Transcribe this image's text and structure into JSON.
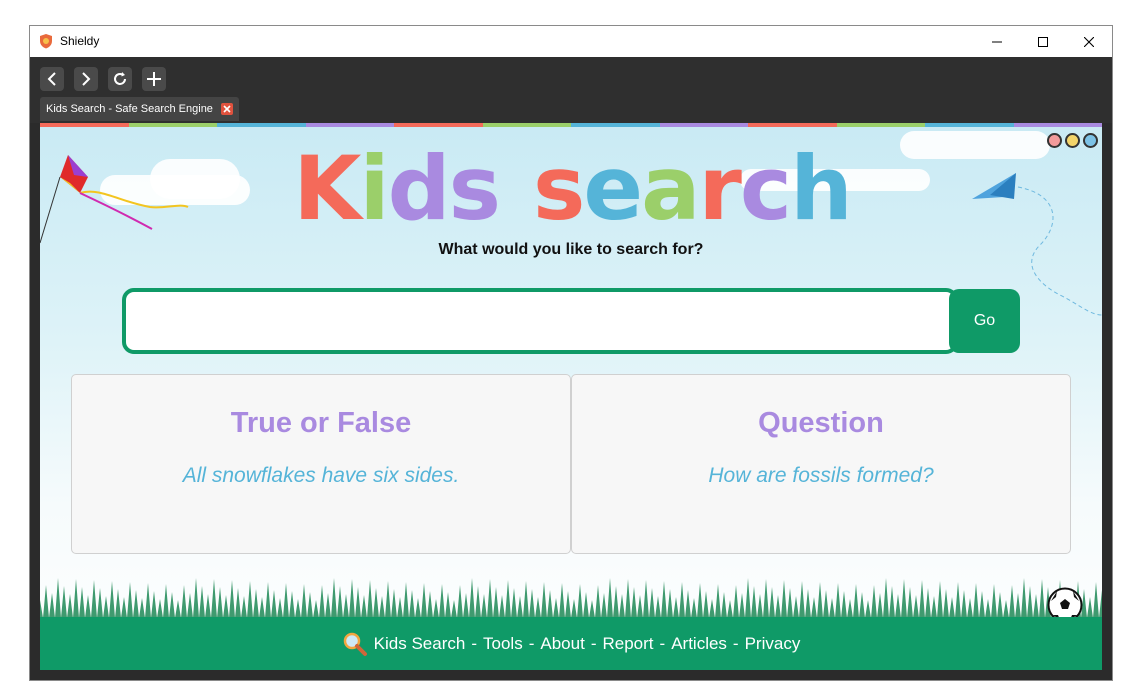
{
  "window": {
    "title": "Shieldy"
  },
  "tab": {
    "label": "Kids Search - Safe Search Engine"
  },
  "logo": {
    "letters1": [
      {
        "ch": "K",
        "color": "#f46a5a"
      },
      {
        "ch": "i",
        "color": "#9bcf6a"
      },
      {
        "ch": "d",
        "color": "#a98ae0"
      },
      {
        "ch": "s",
        "color": "#a98ae0"
      }
    ],
    "letters2": [
      {
        "ch": "s",
        "color": "#f46a5a"
      },
      {
        "ch": "e",
        "color": "#55b4d8"
      },
      {
        "ch": "a",
        "color": "#9bcf6a"
      },
      {
        "ch": "r",
        "color": "#f46a5a"
      },
      {
        "ch": "c",
        "color": "#a98ae0"
      },
      {
        "ch": "h",
        "color": "#55b4d8"
      }
    ]
  },
  "search": {
    "prompt": "What would you like to search for?",
    "value": "",
    "go_label": "Go"
  },
  "cards": {
    "left": {
      "title": "True or False",
      "body": "All snowflakes have six sides."
    },
    "right": {
      "title": "Question",
      "body": "How are fossils formed?"
    }
  },
  "footer": {
    "links": [
      "Kids Search",
      "Tools",
      "About",
      "Report",
      "Articles",
      "Privacy"
    ]
  },
  "colors": {
    "brand_green": "#0f9a67",
    "stripe": [
      "#f46a5a",
      "#9bcf6a",
      "#55b4d8",
      "#a98ae0",
      "#f46a5a",
      "#9bcf6a",
      "#55b4d8",
      "#a98ae0",
      "#f46a5a",
      "#9bcf6a",
      "#55b4d8",
      "#a98ae0"
    ],
    "dots": [
      "#f29b9b",
      "#f3d46a",
      "#7cc2e6"
    ]
  }
}
